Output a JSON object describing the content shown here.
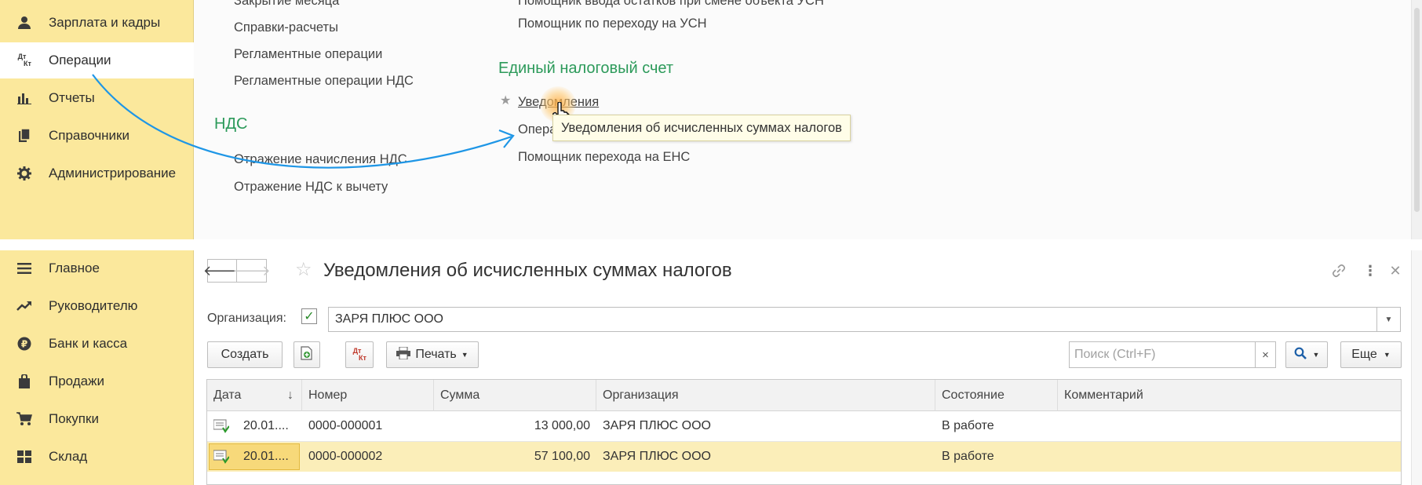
{
  "top_sidebar": {
    "items": [
      {
        "label": "Зарплата и кадры",
        "icon": "person-icon"
      },
      {
        "label": "Операции",
        "icon": "dt-kt-icon",
        "icon_text_top": "Дт",
        "icon_text_bottom": "Кт",
        "active": true
      },
      {
        "label": "Отчеты",
        "icon": "bar-chart-icon"
      },
      {
        "label": "Справочники",
        "icon": "books-icon"
      },
      {
        "label": "Администрирование",
        "icon": "gear-icon"
      }
    ]
  },
  "operations_menu": {
    "col1_links": [
      "Закрытие месяца",
      "Справки-расчеты",
      "Регламентные операции",
      "Регламентные операции НДС"
    ],
    "nds_section": {
      "title": "НДС",
      "links": [
        "Отражение начисления НДС",
        "Отражение НДС к вычету"
      ]
    },
    "col2_links": [
      "Помощник ввода остатков при смене объекта УСН",
      "Помощник по переходу на УСН"
    ],
    "ens_section": {
      "title": "Единый налоговый счет",
      "links": [
        "Уведомления",
        "Операции по ЕНС",
        "Помощник перехода на ЕНС"
      ]
    },
    "tooltip": "Уведомления об исчисленных суммах налогов"
  },
  "bottom_sidebar": {
    "items": [
      {
        "label": "Главное",
        "icon": "menu-icon"
      },
      {
        "label": "Руководителю",
        "icon": "trend-up-icon"
      },
      {
        "label": "Банк и касса",
        "icon": "coin-icon"
      },
      {
        "label": "Продажи",
        "icon": "shopping-bag-icon"
      },
      {
        "label": "Покупки",
        "icon": "cart-icon"
      },
      {
        "label": "Склад",
        "icon": "warehouse-icon"
      }
    ]
  },
  "form": {
    "title": "Уведомления об исчисленных суммах налогов",
    "org_label": "Организация:",
    "org_checked": true,
    "org_value": "ЗАРЯ ПЛЮС ООО",
    "toolbar": {
      "create": "Создать",
      "print": "Печать",
      "dt_kt_top": "Дт",
      "dt_kt_bottom": "Кт",
      "search_placeholder": "Поиск (Ctrl+F)",
      "more": "Еще"
    },
    "table": {
      "columns": [
        "Дата",
        "Номер",
        "Сумма",
        "Организация",
        "Состояние",
        "Комментарий"
      ],
      "rows": [
        {
          "date": "20.01....",
          "number": "0000-000001",
          "amount": "13 000,00",
          "org": "ЗАРЯ ПЛЮС ООО",
          "status": "В работе",
          "comment": ""
        },
        {
          "date": "20.01....",
          "number": "0000-000002",
          "amount": "57 100,00",
          "org": "ЗАРЯ ПЛЮС ООО",
          "status": "В работе",
          "comment": "",
          "selected": true
        }
      ]
    }
  },
  "colors": {
    "sidebar_bg": "#fbe89c",
    "section_title": "#2c9a5a",
    "arrow": "#1e96e6",
    "selected_row": "#fbeeb9"
  }
}
